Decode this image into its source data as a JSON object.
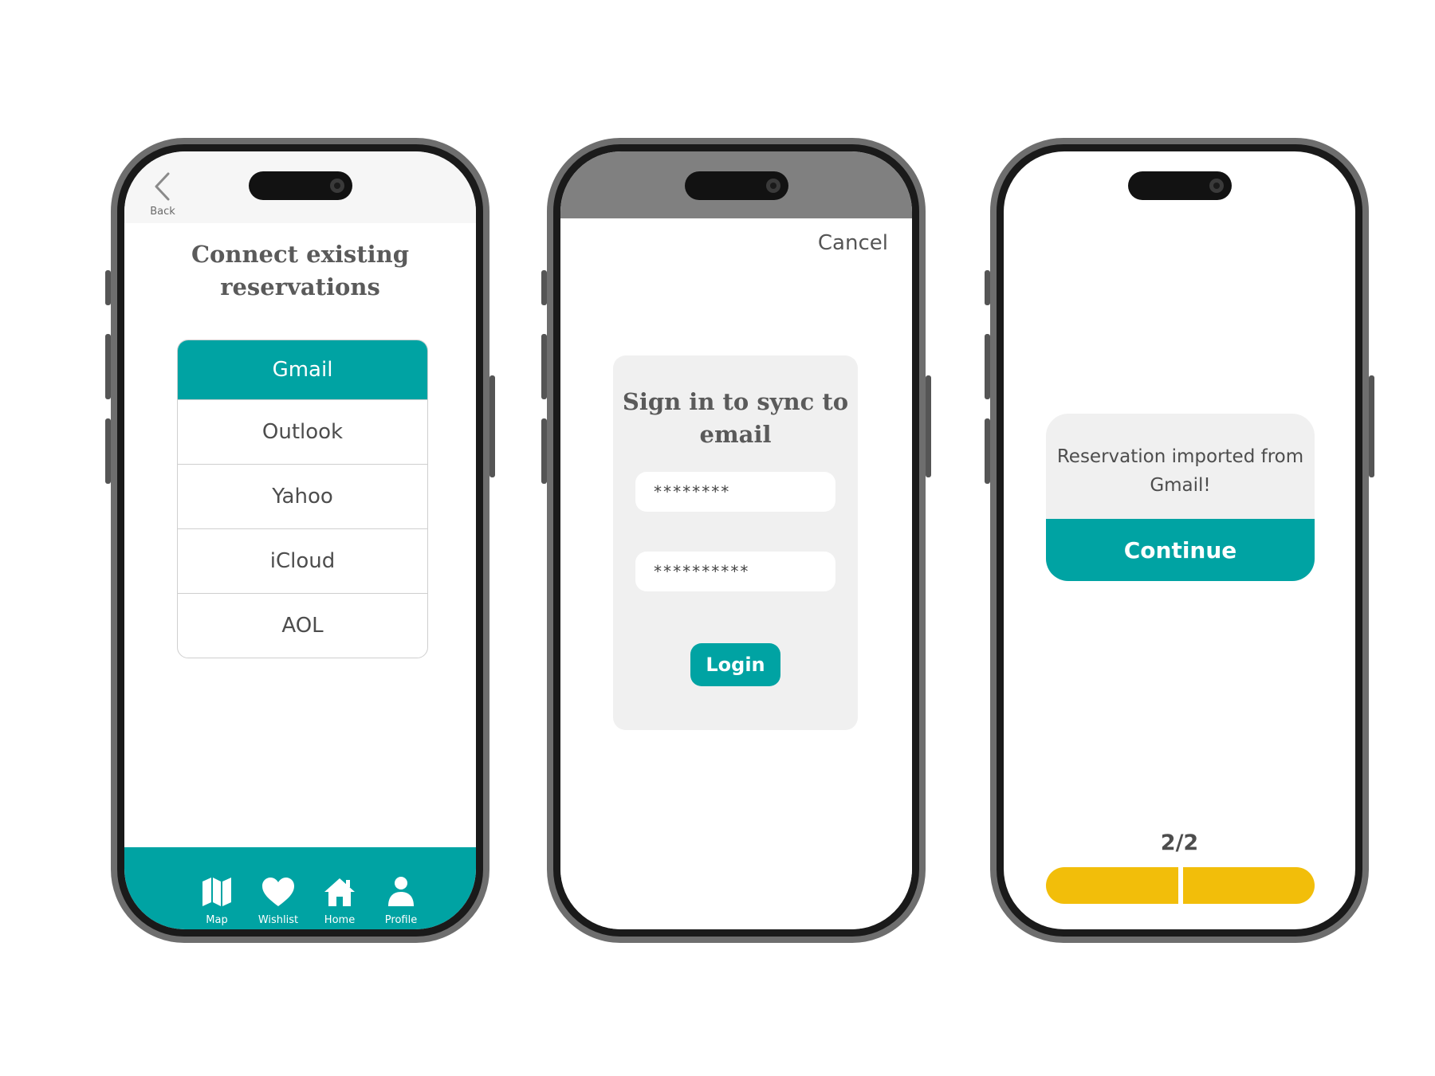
{
  "colors": {
    "teal": "#00a3a3",
    "yellow": "#f2be0a",
    "frame_gray": "#6e6e6e",
    "card_gray": "#f0f0f0",
    "modal_backdrop": "#808080"
  },
  "screen1": {
    "back_label": "Back",
    "back_icon": "chevron-left-icon",
    "title": "Connect existing reservations",
    "providers": [
      {
        "label": "Gmail",
        "selected": true
      },
      {
        "label": "Outlook",
        "selected": false
      },
      {
        "label": "Yahoo",
        "selected": false
      },
      {
        "label": "iCloud",
        "selected": false
      },
      {
        "label": "AOL",
        "selected": false
      }
    ],
    "tabbar": [
      {
        "label": "Map",
        "icon": "map-icon"
      },
      {
        "label": "Wishlist",
        "icon": "heart-icon"
      },
      {
        "label": "Home",
        "icon": "home-icon"
      },
      {
        "label": "Profile",
        "icon": "profile-icon"
      }
    ]
  },
  "screen2": {
    "cancel_label": "Cancel",
    "title": "Sign in to sync to email",
    "field1_value": "********",
    "field2_value": "**********",
    "login_label": "Login"
  },
  "screen3": {
    "message": "Reservation imported from Gmail!",
    "continue_label": "Continue",
    "step_label": "2/2",
    "progress": {
      "current": 2,
      "total": 2
    }
  }
}
